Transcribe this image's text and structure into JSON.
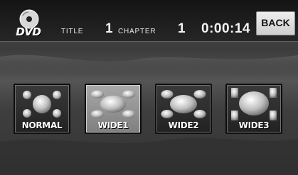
{
  "header": {
    "logo_text": "DVD",
    "title_label": "TITLE",
    "title_value": "1",
    "chapter_label": "CHAPTER",
    "chapter_value": "1",
    "elapsed_time": "0:00:14",
    "back_label": "BACK"
  },
  "modes": [
    {
      "label": "NORMAL",
      "icon": "aspect-normal-icon",
      "selected": false
    },
    {
      "label": "WIDE1",
      "icon": "aspect-wide1-icon",
      "selected": true
    },
    {
      "label": "WIDE2",
      "icon": "aspect-wide2-icon",
      "selected": false
    },
    {
      "label": "WIDE3",
      "icon": "aspect-wide3-icon",
      "selected": false
    }
  ],
  "colors": {
    "selected_button": "#9a9a9a",
    "button_face": "#2e2e2e",
    "text": "#ffffff"
  }
}
